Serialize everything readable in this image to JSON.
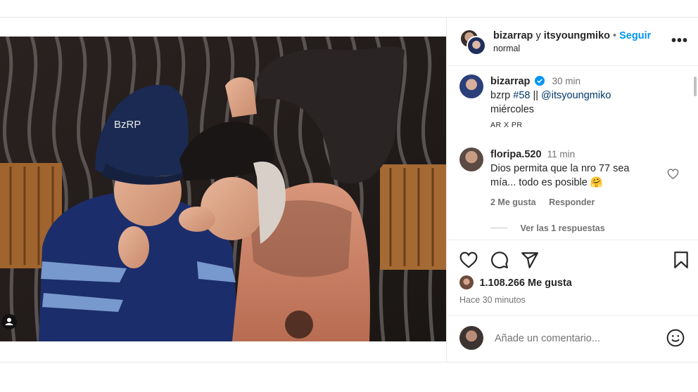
{
  "post": {
    "header": {
      "usernames_primary": "bizarrap",
      "conjunction": "y",
      "usernames_secondary": "itsyoungmiko",
      "dot": "•",
      "follow_label": "Seguir",
      "subtitle": "normal",
      "more_label": "•••"
    },
    "caption": {
      "username": "bizarrap",
      "verified": true,
      "time": "30 min",
      "line1_prefix": "bzrp ",
      "hashtag": "#58",
      "line1_sep": " || ",
      "mention": "@itsyoungmiko",
      "line2": "miércoles",
      "translate": "AR X PR"
    },
    "comments": [
      {
        "username": "floripa.520",
        "time": "11 min",
        "text_line1": "Dios permita que la nro 77 sea",
        "text_line2": "mía... todo es posible 🤗",
        "likes": "2 Me gusta",
        "reply_label": "Responder",
        "view_replies": "Ver las 1 respuestas"
      }
    ],
    "likes_count": "1.108.266 Me gusta",
    "timestamp": "Hace 30 minutos",
    "comment_placeholder": "Añade un comentario...",
    "image_text": "BzRP",
    "colors": {
      "accent": "#0095f6",
      "text": "#262626",
      "muted": "#737373",
      "verified": "#0095f6"
    }
  }
}
